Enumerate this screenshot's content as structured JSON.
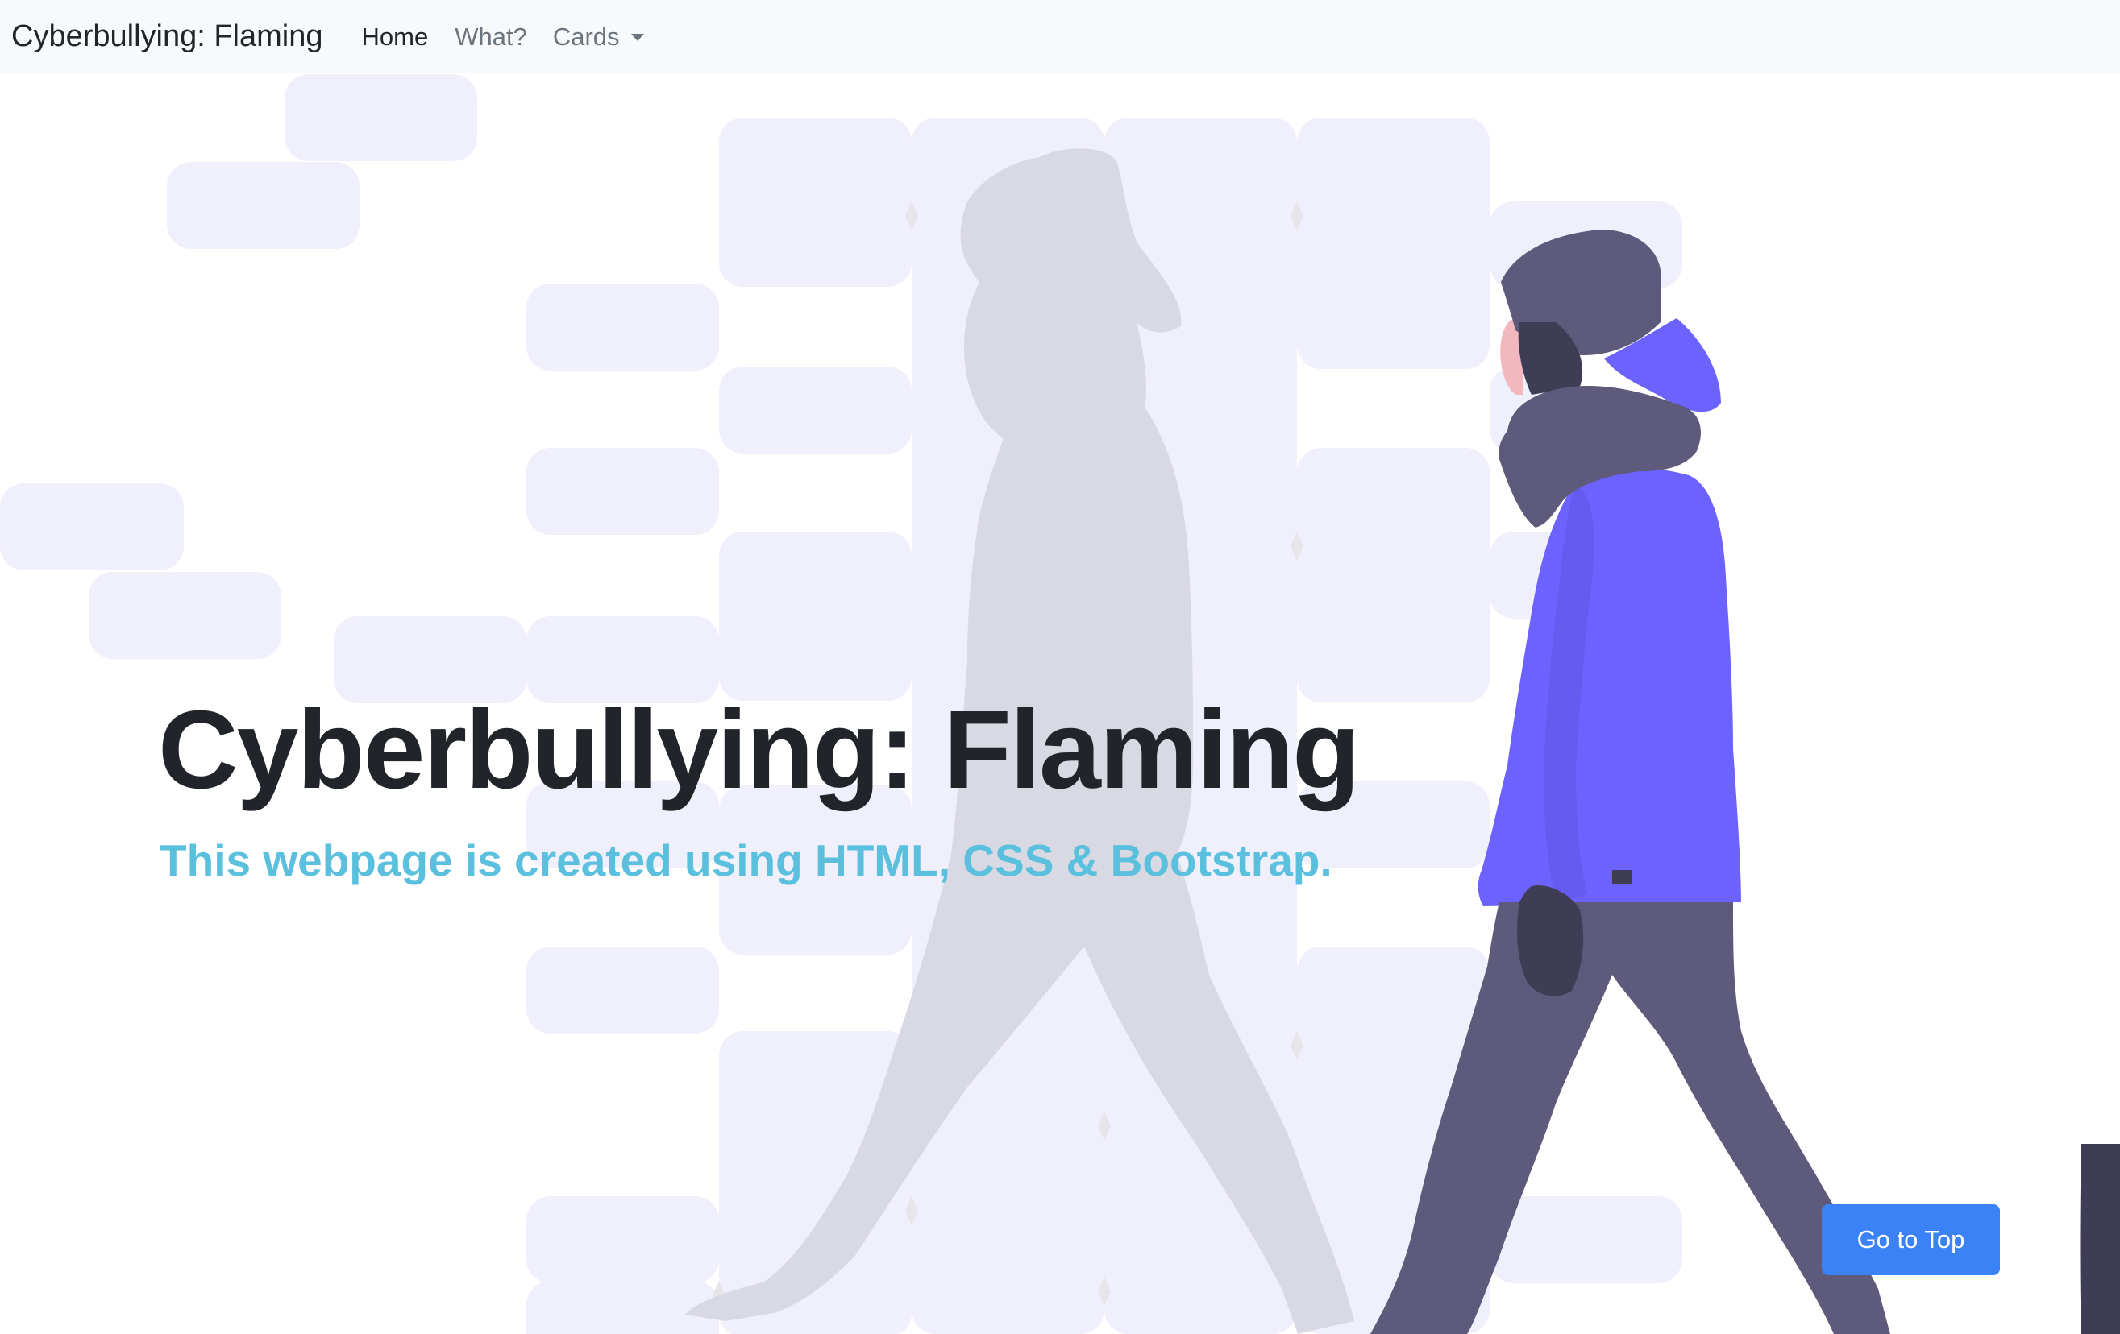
{
  "navbar": {
    "brand": "Cyberbullying: Flaming",
    "links": [
      {
        "label": "Home"
      },
      {
        "label": "What?"
      },
      {
        "label": "Cards"
      }
    ]
  },
  "hero": {
    "title": "Cyberbullying: Flaming",
    "subtitle": "This webpage is created using HTML, CSS & Bootstrap."
  },
  "actions": {
    "go_top": "Go to Top"
  },
  "colors": {
    "navbar_bg": "#f8f9fa",
    "title": "#212529",
    "subtitle": "#5bc0de",
    "button": "#3b82f6",
    "jacket": "#6c63ff",
    "pants": "#5e5a7b",
    "shadow_figure": "#d9d9e3",
    "tile": "#f0effc"
  },
  "icons": {
    "dropdown": "caret-down-icon"
  }
}
